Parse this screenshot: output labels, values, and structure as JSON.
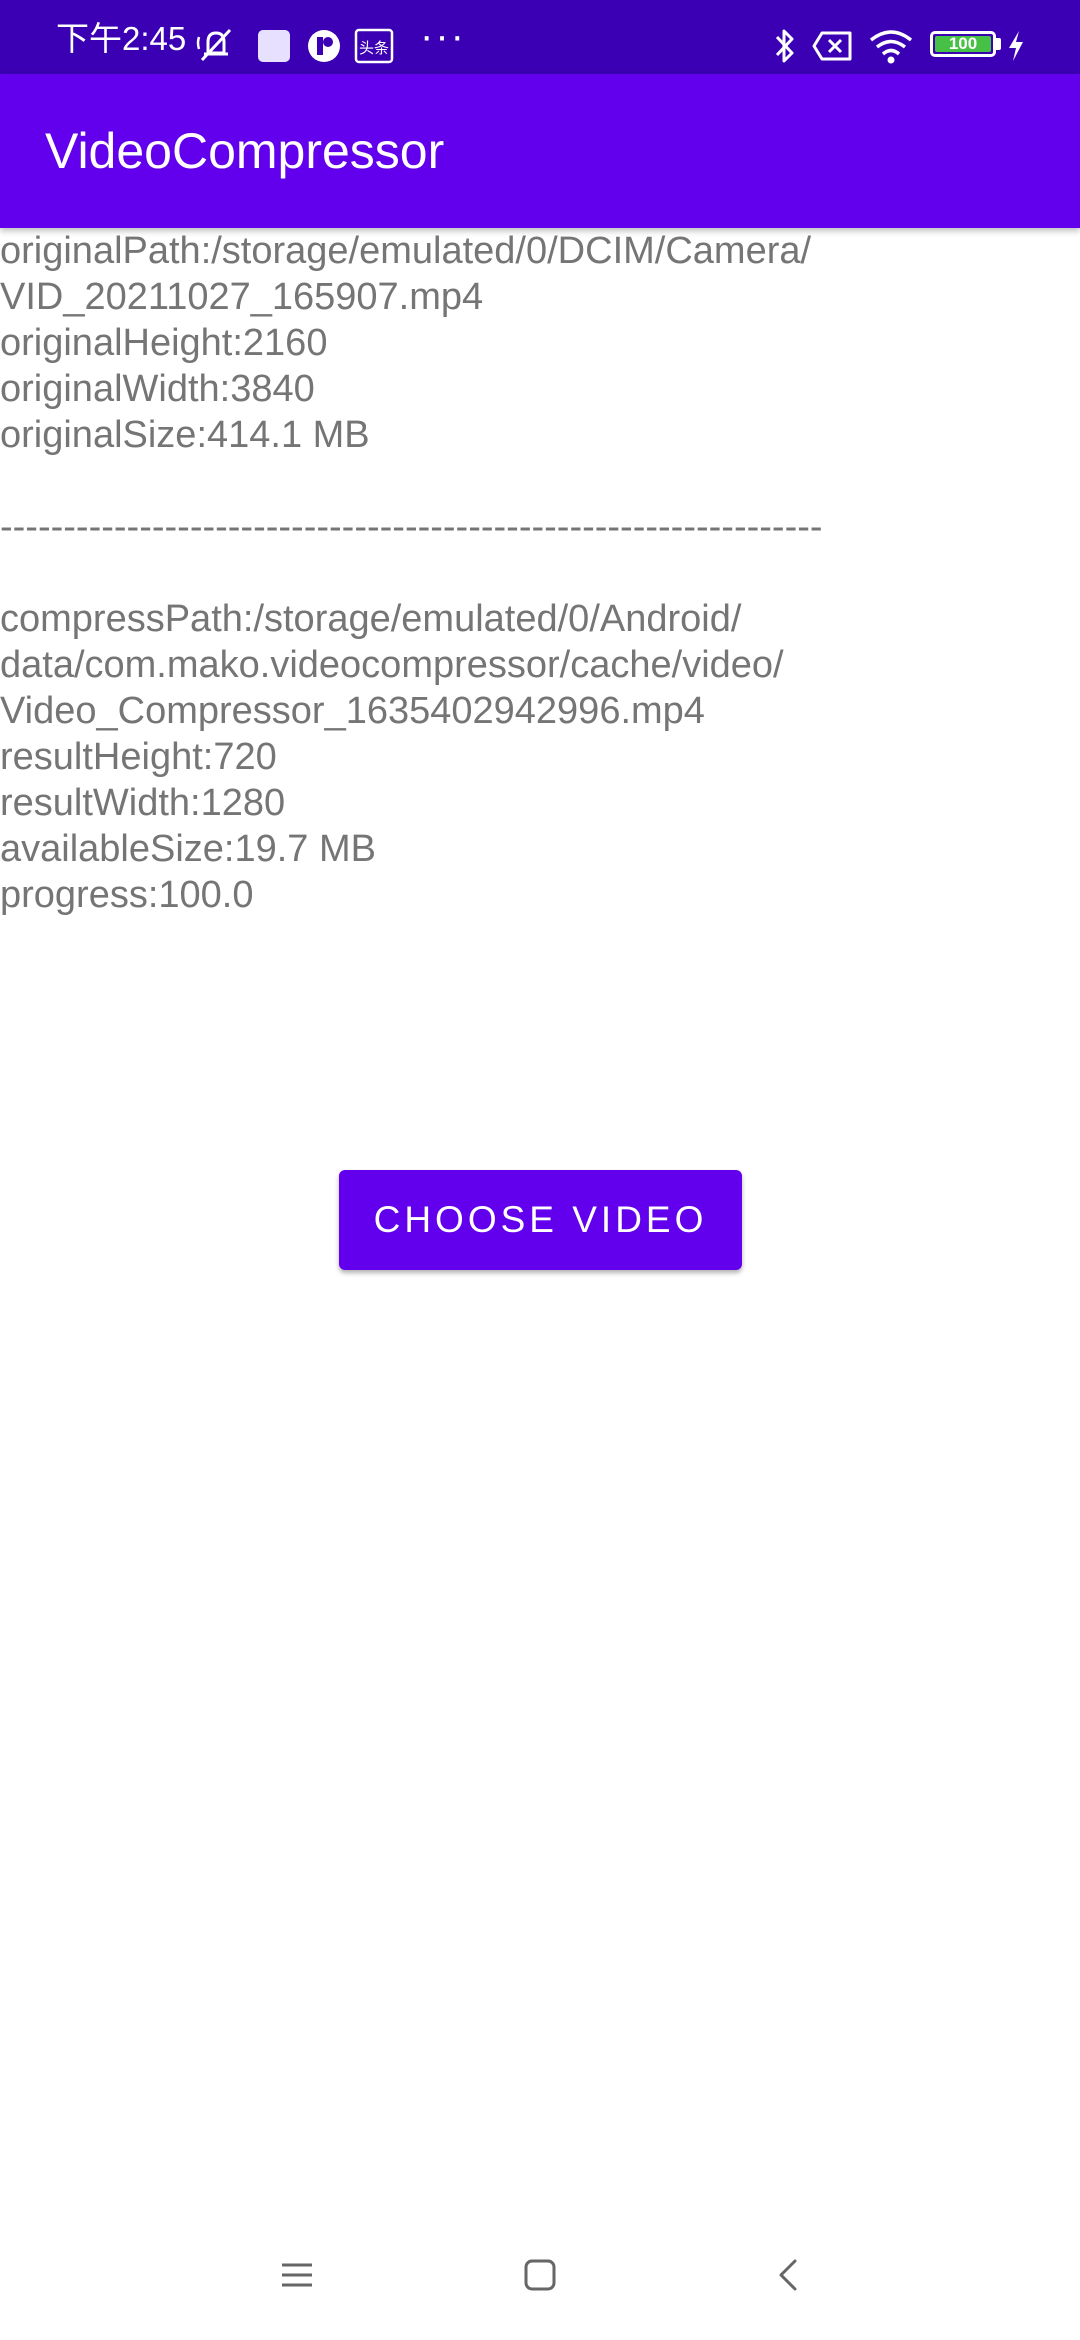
{
  "status_bar": {
    "time": "下午2:45",
    "dots": "···",
    "battery_level": "100",
    "icons": [
      "mute-bell-icon",
      "square-notification-icon",
      "app-notification-icon",
      "toutiao-icon",
      "more-icon",
      "bluetooth-icon",
      "sim-x-icon",
      "wifi-icon",
      "battery-icon",
      "charging-icon"
    ]
  },
  "app_bar": {
    "title": "VideoCompressor",
    "color": "#6200ee"
  },
  "content": {
    "original_path_1": "originalPath:/storage/emulated/0/DCIM/Camera/",
    "original_path_2": "VID_20211027_165907.mp4",
    "original_height": "originalHeight:2160",
    "original_width": "originalWidth:3840",
    "original_size": "originalSize:414.1 MB",
    "separator": "-----------------------------------------------------------------",
    "compress_path_1": "compressPath:/storage/emulated/0/Android/",
    "compress_path_2": "data/com.mako.videocompressor/cache/video/",
    "compress_path_3": "Video_Compressor_1635402942996.mp4",
    "result_height": "resultHeight:720",
    "result_width": "resultWidth:1280",
    "available_size": "availableSize:19.7 MB",
    "progress": "progress:100.0"
  },
  "button": {
    "label": "CHOOSE VIDEO"
  },
  "nav_bar": {
    "icons": [
      "menu-icon",
      "home-icon",
      "back-icon"
    ]
  }
}
